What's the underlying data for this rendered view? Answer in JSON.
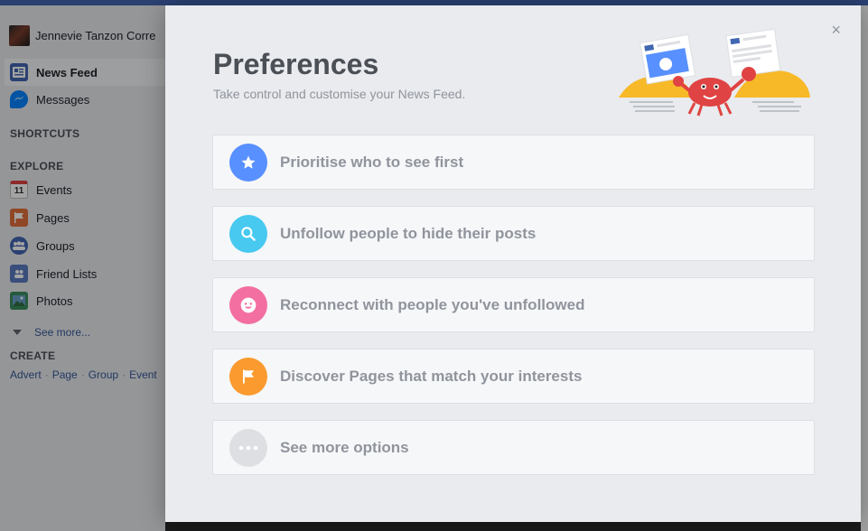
{
  "background": {
    "profile_name": "Jennevie Tanzon Corre",
    "nav": [
      {
        "label": "News Feed",
        "icon": "news-feed-icon"
      },
      {
        "label": "Messages",
        "icon": "messages-icon"
      }
    ],
    "shortcuts_heading": "SHORTCUTS",
    "explore_heading": "EXPLORE",
    "explore_items": [
      {
        "label": "Events",
        "icon": "calendar-icon",
        "icon_text": "11"
      },
      {
        "label": "Pages",
        "icon": "flag-icon"
      },
      {
        "label": "Groups",
        "icon": "groups-icon"
      },
      {
        "label": "Friend Lists",
        "icon": "friend-lists-icon"
      },
      {
        "label": "Photos",
        "icon": "photos-icon"
      }
    ],
    "see_more": "See more...",
    "create_heading": "CREATE",
    "create_links": [
      "Advert",
      "Page",
      "Group",
      "Event"
    ]
  },
  "modal": {
    "title": "Preferences",
    "subtitle": "Take control and customise your News Feed.",
    "close_label": "×",
    "options": [
      {
        "label": "Prioritise who to see first",
        "icon": "star-icon",
        "color": "#5890ff"
      },
      {
        "label": "Unfollow people to hide their posts",
        "icon": "search-icon",
        "color": "#47c9f0"
      },
      {
        "label": "Reconnect with people you've unfollowed",
        "icon": "smiley-icon",
        "color": "#f36fa1"
      },
      {
        "label": "Discover Pages that match your interests",
        "icon": "flag-icon",
        "color": "#fa9a2f"
      },
      {
        "label": "See more options",
        "icon": "more-icon",
        "color": "#dddfe2"
      }
    ]
  },
  "colors": {
    "brand": "#4267b2",
    "link": "#365899",
    "muted_text": "#90949c"
  }
}
